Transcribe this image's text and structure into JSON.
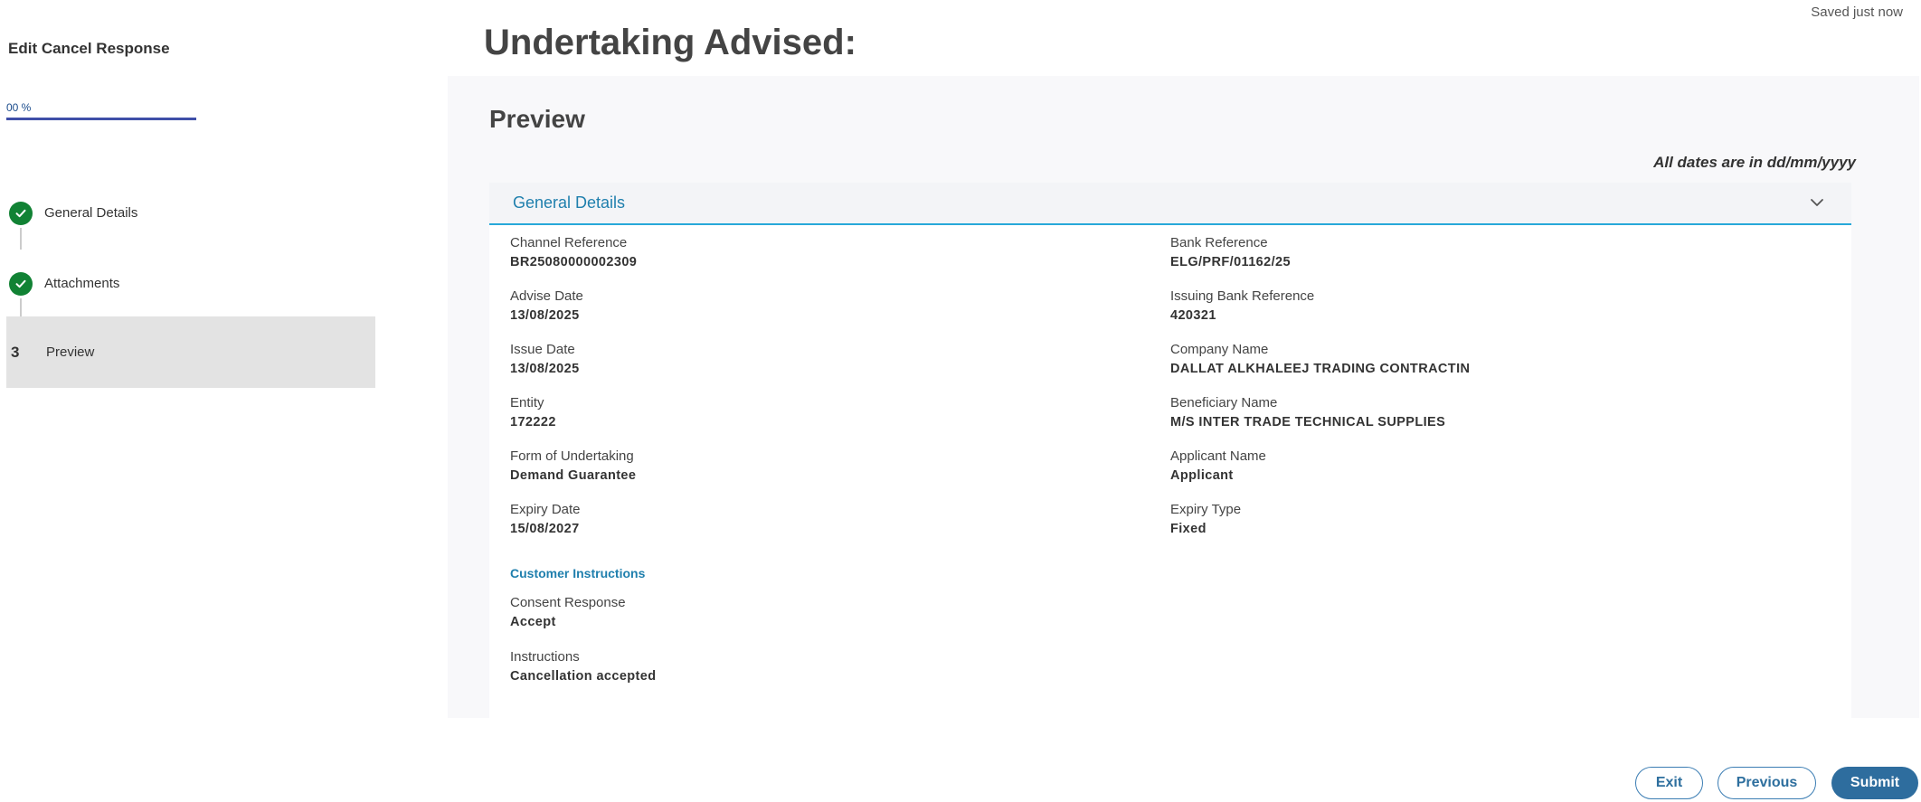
{
  "sidebar": {
    "title": "Edit Cancel Response",
    "progress_label": "00 %",
    "progress_fraction": 1.0,
    "steps": [
      {
        "label": "General Details",
        "state": "done"
      },
      {
        "label": "Attachments",
        "state": "done"
      },
      {
        "number": "3",
        "label": "Preview",
        "state": "active"
      }
    ]
  },
  "header": {
    "saved_status": "Saved just now",
    "page_title": "Undertaking Advised:"
  },
  "main": {
    "preview_title": "Preview",
    "dates_note": "All dates are in dd/mm/yyyy",
    "section": {
      "title": "General Details",
      "icon": "chevron-down-icon",
      "fields": [
        {
          "label": "Channel Reference",
          "value": "BR25080000002309"
        },
        {
          "label": "Bank Reference",
          "value": "ELG/PRF/01162/25"
        },
        {
          "label": "Advise Date",
          "value": "13/08/2025"
        },
        {
          "label": "Issuing Bank Reference",
          "value": "420321"
        },
        {
          "label": "Issue Date",
          "value": "13/08/2025"
        },
        {
          "label": "Company Name",
          "value": "DALLAT ALKHALEEJ TRADING CONTRACTIN"
        },
        {
          "label": "Entity",
          "value": "172222"
        },
        {
          "label": "Beneficiary Name",
          "value": "M/S INTER TRADE TECHNICAL SUPPLIES"
        },
        {
          "label": "Form of Undertaking",
          "value": "Demand Guarantee"
        },
        {
          "label": "Applicant Name",
          "value": "Applicant"
        },
        {
          "label": "Expiry Date",
          "value": "15/08/2027"
        },
        {
          "label": "Expiry Type",
          "value": "Fixed"
        }
      ],
      "customer_instructions": {
        "heading": "Customer Instructions",
        "fields": [
          {
            "label": "Consent Response",
            "value": "Accept"
          },
          {
            "label": "Instructions",
            "value": "Cancellation accepted"
          }
        ]
      }
    }
  },
  "footer": {
    "exit_label": "Exit",
    "previous_label": "Previous",
    "submit_label": "Submit"
  },
  "colors": {
    "accent": "#1f7fad",
    "success": "#118234",
    "primary_button": "#2e6d9e",
    "progress": "#3f4fa8"
  }
}
